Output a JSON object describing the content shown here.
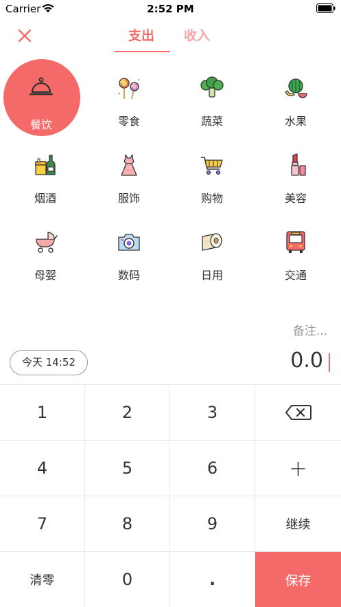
{
  "status_bar": {
    "carrier": "Carrier",
    "time": "2:52 PM"
  },
  "nav": {
    "tabs": [
      {
        "label": "支出",
        "selected": true
      },
      {
        "label": "收入",
        "selected": false
      }
    ]
  },
  "categories": [
    {
      "label": "餐饮",
      "icon": "cloche-icon",
      "selected": true
    },
    {
      "label": "零食",
      "icon": "lollipop-icon",
      "selected": false
    },
    {
      "label": "蔬菜",
      "icon": "broccoli-icon",
      "selected": false
    },
    {
      "label": "水果",
      "icon": "fruit-icon",
      "selected": false
    },
    {
      "label": "烟酒",
      "icon": "cigarette-wine-icon",
      "selected": false
    },
    {
      "label": "服饰",
      "icon": "dress-icon",
      "selected": false
    },
    {
      "label": "购物",
      "icon": "shopping-cart-icon",
      "selected": false
    },
    {
      "label": "美容",
      "icon": "lipstick-icon",
      "selected": false
    },
    {
      "label": "母婴",
      "icon": "stroller-icon",
      "selected": false
    },
    {
      "label": "数码",
      "icon": "camera-icon",
      "selected": false
    },
    {
      "label": "日用",
      "icon": "tissue-roll-icon",
      "selected": false
    },
    {
      "label": "交通",
      "icon": "bus-icon",
      "selected": false
    }
  ],
  "note_placeholder": "备注...",
  "date_label": "今天 14:52",
  "amount": "0.0",
  "keypad": {
    "keys": [
      "1",
      "2",
      "3",
      "",
      "4",
      "5",
      "6",
      "+",
      "7",
      "8",
      "9",
      "继续",
      "清零",
      "0",
      ".",
      "保存"
    ]
  },
  "colors": {
    "accent": "#f46a69",
    "accent_light": "#f5a5a3"
  }
}
